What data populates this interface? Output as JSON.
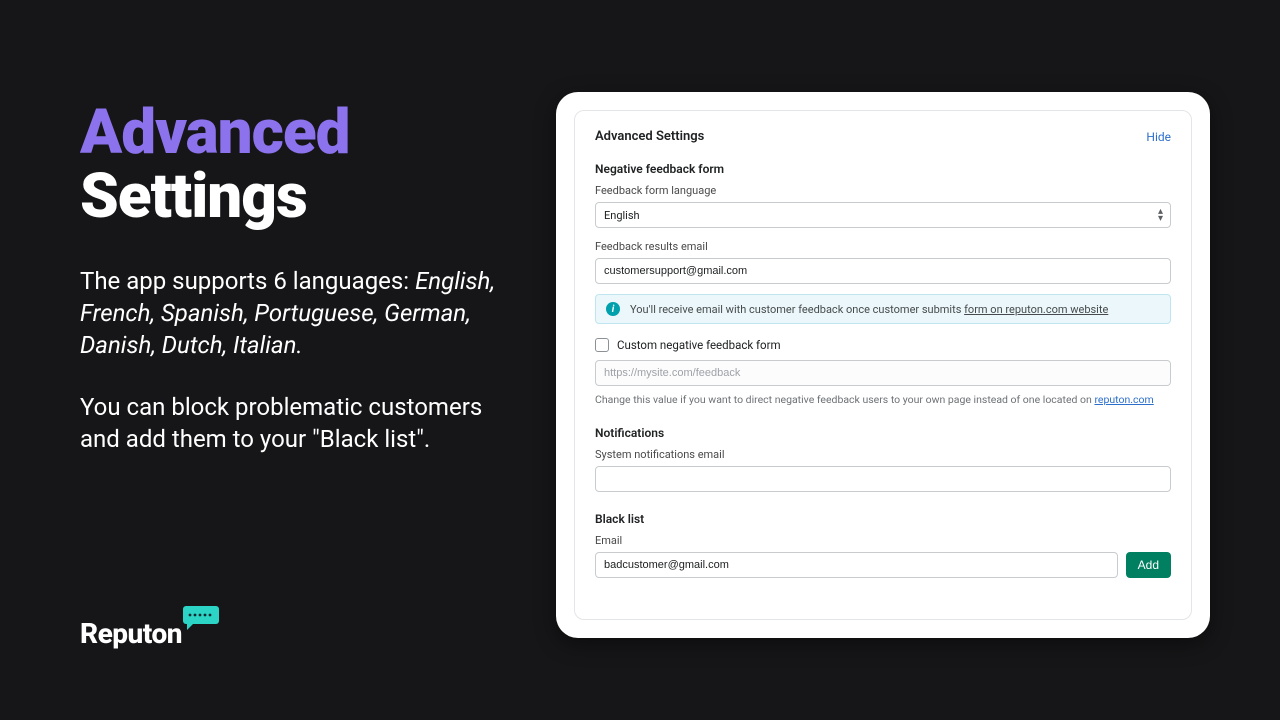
{
  "left": {
    "title_line1": "Advanced",
    "title_line2": "Settings",
    "p1_lead": "The app supports 6 languages: ",
    "p1_langs": "English, French, Spanish, Portuguese, German, Danish, Dutch, Italian.",
    "p2": "You can block problematic customers and add them to your \"Black list\"."
  },
  "logo": {
    "name": "Reputon"
  },
  "panel": {
    "header_title": "Advanced Settings",
    "hide_label": "Hide",
    "negative": {
      "section_title": "Negative feedback form",
      "lang_label": "Feedback form language",
      "lang_value": "English",
      "email_label": "Feedback results email",
      "email_value": "customersupport@gmail.com",
      "info_text": "You'll receive email with customer feedback once customer submits ",
      "info_link": "form on reputon.com website",
      "custom_label": "Custom negative feedback form",
      "custom_placeholder": "https://mysite.com/feedback",
      "helper_text": "Change this value if you want to direct negative feedback users to your own page instead of one located on ",
      "helper_link": "reputon.com"
    },
    "notifications": {
      "section_title": "Notifications",
      "email_label": "System notifications email",
      "email_value": ""
    },
    "blacklist": {
      "section_title": "Black list",
      "email_label": "Email",
      "email_value": "badcustomer@gmail.com",
      "add_label": "Add"
    }
  }
}
